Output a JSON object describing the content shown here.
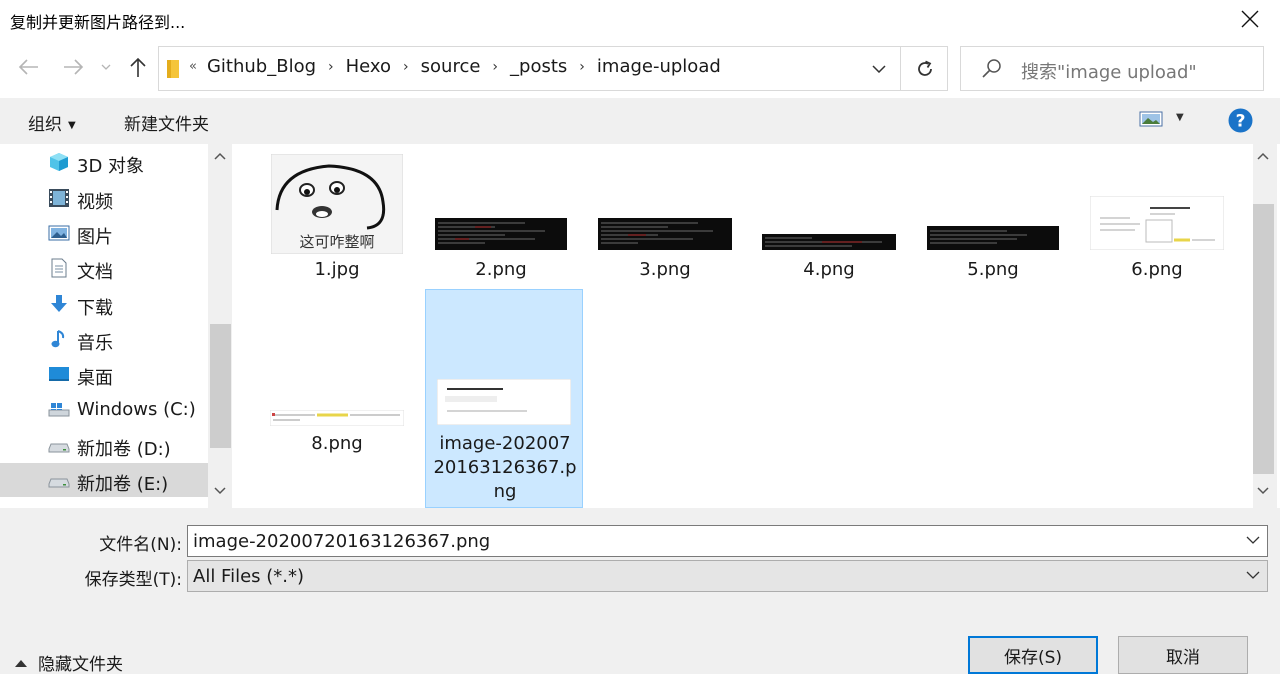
{
  "window": {
    "title": "复制并更新图片路径到..."
  },
  "addressbar": {
    "overflow": "«",
    "crumbs": [
      "Github_Blog",
      "Hexo",
      "source",
      "_posts",
      "image-upload"
    ]
  },
  "search": {
    "placeholder": "搜索\"image upload\""
  },
  "toolbar": {
    "organize": "组织",
    "new_folder": "新建文件夹"
  },
  "sidebar": {
    "items": [
      {
        "label": "3D 对象",
        "icon": "3d-objects-icon"
      },
      {
        "label": "视频",
        "icon": "video-icon"
      },
      {
        "label": "图片",
        "icon": "pictures-icon"
      },
      {
        "label": "文档",
        "icon": "documents-icon"
      },
      {
        "label": "下载",
        "icon": "download-icon"
      },
      {
        "label": "音乐",
        "icon": "music-icon"
      },
      {
        "label": "桌面",
        "icon": "desktop-icon"
      },
      {
        "label": "Windows  (C:)",
        "icon": "windows-drive-icon"
      },
      {
        "label": "新加卷 (D:)",
        "icon": "drive-icon"
      },
      {
        "label": "新加卷 (E:)",
        "icon": "drive-icon",
        "selected": true
      }
    ]
  },
  "files": [
    {
      "name": "1.jpg",
      "thumb": "meme",
      "meme_text": "这可咋整啊"
    },
    {
      "name": "2.png",
      "thumb": "terminal"
    },
    {
      "name": "3.png",
      "thumb": "terminal"
    },
    {
      "name": "4.png",
      "thumb": "terminal-thin"
    },
    {
      "name": "5.png",
      "thumb": "terminal"
    },
    {
      "name": "6.png",
      "thumb": "document"
    },
    {
      "name": "8.png",
      "thumb": "line"
    },
    {
      "name": "image-2020072016312636​7.png",
      "display_lines": [
        "image-202007",
        "20163126367.p",
        "ng"
      ],
      "thumb": "doc-card",
      "selected": true
    }
  ],
  "form": {
    "filename_label": "文件名(N):",
    "filename_value": "image-20200720163126367.png",
    "filetype_label": "保存类型(T):",
    "filetype_value": "All Files (*.*)"
  },
  "footer": {
    "hide_folders": "隐藏文件夹",
    "save": "保存(S)",
    "cancel": "取消"
  },
  "colors": {
    "accent": "#0078d7",
    "selection": "#cce8ff",
    "help": "#1a73c8"
  }
}
